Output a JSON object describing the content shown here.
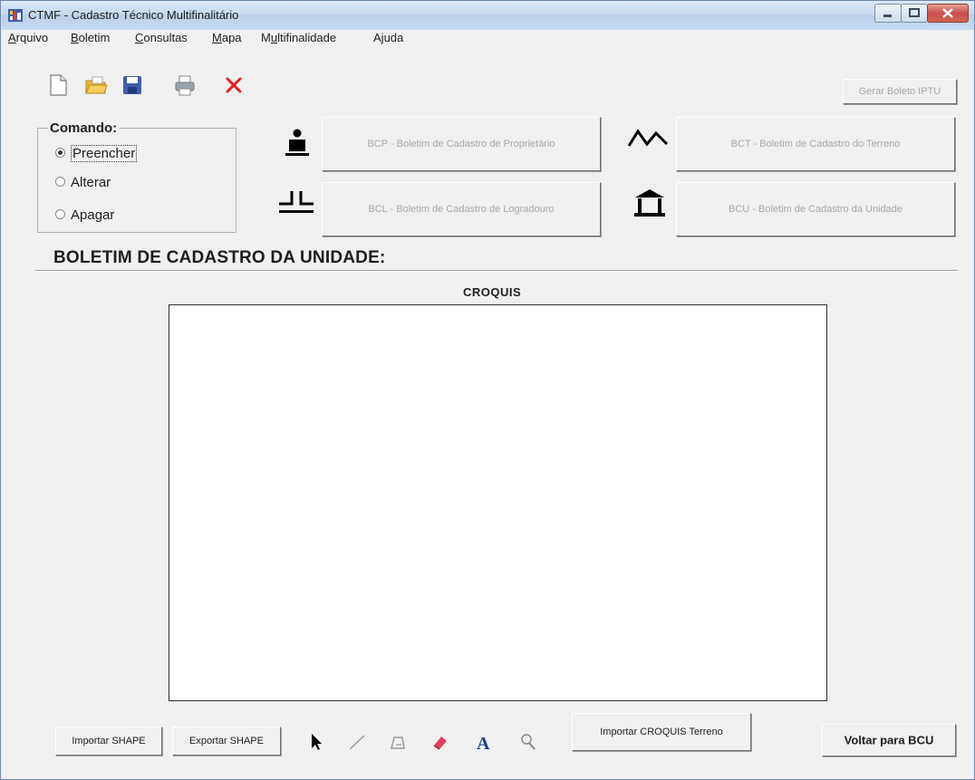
{
  "window": {
    "title": "CTMF - Cadastro Técnico Multifinalitário"
  },
  "menu": [
    {
      "pre": "",
      "u": "A",
      "post": "rquivo"
    },
    {
      "pre": "",
      "u": "B",
      "post": "oletim"
    },
    {
      "pre": "",
      "u": "C",
      "post": "onsultas"
    },
    {
      "pre": "",
      "u": "M",
      "post": "apa"
    },
    {
      "pre": "M",
      "u": "u",
      "post": "ltifinalidade"
    },
    {
      "pre": "A",
      "u": "j",
      "post": "uda"
    }
  ],
  "toolbar": {
    "icons": [
      "new-document-icon",
      "open-folder-icon",
      "save-icon",
      "print-icon",
      "delete-x-icon"
    ],
    "gerar_boleto_label": "Gerar Boleto IPTU"
  },
  "comando": {
    "legend": "Comando:",
    "options": [
      "Preencher",
      "Alterar",
      "Apagar"
    ],
    "selected": "Preencher"
  },
  "boletins": {
    "bcp": "BCP - Boletim de Cadastro de Proprietário",
    "bct": "BCT - Boletim de Cadastro do Terreno",
    "bcl": "BCL - Boletim de Cadastro de Logradouro",
    "bcu": "BCU - Boletim de Cadastro da Unidade"
  },
  "section": {
    "title": "BOLETIM DE CADASTRO DA UNIDADE:",
    "croquis_label": "CROQUIS"
  },
  "bottom": {
    "importar_shape": "Importar SHAPE",
    "exportar_shape": "Exportar SHAPE",
    "importar_croquis": "Importar CROQUIS Terreno",
    "voltar": "Voltar para BCU",
    "tools": [
      "pointer-arrow-icon",
      "line-tool-icon",
      "polygon-tool-icon",
      "eraser-icon",
      "text-tool-icon",
      "zoom-icon"
    ]
  },
  "colors": {
    "titlebar": "#c7d9ef",
    "window_bg": "#f0f0f0",
    "disabled_text": "#a8a8a8",
    "close_button": "#c75050",
    "delete_icon": "#e02020",
    "text_tool": "#1a3f8f",
    "eraser": "#e0405a"
  }
}
